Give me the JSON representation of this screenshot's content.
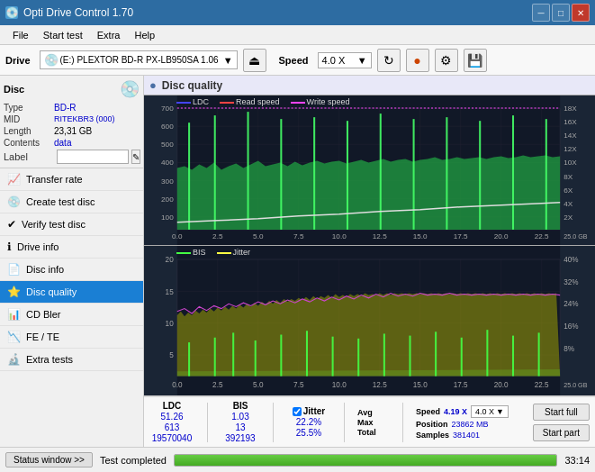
{
  "app": {
    "title": "Opti Drive Control 1.70",
    "icon": "💿"
  },
  "titlebar": {
    "minimize_label": "─",
    "maximize_label": "□",
    "close_label": "✕"
  },
  "menubar": {
    "items": [
      "File",
      "Start test",
      "Extra",
      "Help"
    ]
  },
  "toolbar": {
    "drive_label": "Drive",
    "drive_value": "(E:)  PLEXTOR BD-R  PX-LB950SA 1.06",
    "speed_label": "Speed",
    "speed_value": "4.0 X"
  },
  "disc": {
    "section_title": "Disc",
    "type_label": "Type",
    "type_value": "BD-R",
    "mid_label": "MID",
    "mid_value": "RITEKBR3 (000)",
    "length_label": "Length",
    "length_value": "23,31 GB",
    "contents_label": "Contents",
    "contents_value": "data",
    "label_label": "Label",
    "label_value": ""
  },
  "nav": {
    "items": [
      {
        "id": "transfer-rate",
        "label": "Transfer rate",
        "icon": "📈"
      },
      {
        "id": "create-test-disc",
        "label": "Create test disc",
        "icon": "💿"
      },
      {
        "id": "verify-test-disc",
        "label": "Verify test disc",
        "icon": "✔"
      },
      {
        "id": "drive-info",
        "label": "Drive info",
        "icon": "ℹ"
      },
      {
        "id": "disc-info",
        "label": "Disc info",
        "icon": "📄"
      },
      {
        "id": "disc-quality",
        "label": "Disc quality",
        "icon": "⭐",
        "active": true
      },
      {
        "id": "cd-bler",
        "label": "CD Bler",
        "icon": "📊"
      },
      {
        "id": "fe-te",
        "label": "FE / TE",
        "icon": "📉"
      },
      {
        "id": "extra-tests",
        "label": "Extra tests",
        "icon": "🔬"
      }
    ]
  },
  "disc_quality": {
    "title": "Disc quality",
    "legend_top": [
      "LDC",
      "Read speed",
      "Write speed"
    ],
    "legend_bottom": [
      "BIS",
      "Jitter"
    ],
    "chart_top": {
      "y_max": 700,
      "y_labels_left": [
        700,
        600,
        500,
        400,
        300,
        200,
        100
      ],
      "y_labels_right": [
        "18X",
        "16X",
        "14X",
        "12X",
        "10X",
        "8X",
        "6X",
        "4X",
        "2X"
      ],
      "x_labels": [
        "0.0",
        "2.5",
        "5.0",
        "7.5",
        "10.0",
        "12.5",
        "15.0",
        "17.5",
        "20.0",
        "22.5",
        "25.0 GB"
      ]
    },
    "chart_bottom": {
      "y_max": 20,
      "y_labels_left": [
        20,
        15,
        10,
        5
      ],
      "y_labels_right": [
        "40%",
        "32%",
        "24%",
        "16%",
        "8%"
      ],
      "x_labels": [
        "0.0",
        "2.5",
        "5.0",
        "7.5",
        "10.0",
        "12.5",
        "15.0",
        "17.5",
        "20.0",
        "22.5",
        "25.0 GB"
      ]
    }
  },
  "stats": {
    "col_headers": [
      "",
      "LDC",
      "BIS",
      "",
      "Jitter",
      "Speed",
      ""
    ],
    "avg_label": "Avg",
    "max_label": "Max",
    "total_label": "Total",
    "ldc_avg": "51.26",
    "ldc_max": "613",
    "ldc_total": "19570040",
    "bis_avg": "1.03",
    "bis_max": "13",
    "bis_total": "392193",
    "jitter_avg": "22.2%",
    "jitter_max": "25.5%",
    "jitter_checked": true,
    "speed_label": "Speed",
    "speed_value": "4.19 X",
    "speed_select": "4.0 X",
    "position_label": "Position",
    "position_value": "23862 MB",
    "samples_label": "Samples",
    "samples_value": "381401",
    "start_full_label": "Start full",
    "start_part_label": "Start part"
  },
  "statusbar": {
    "status_window_label": "Status window >>",
    "status_text": "Test completed",
    "progress_percent": 100,
    "time": "33:14"
  }
}
